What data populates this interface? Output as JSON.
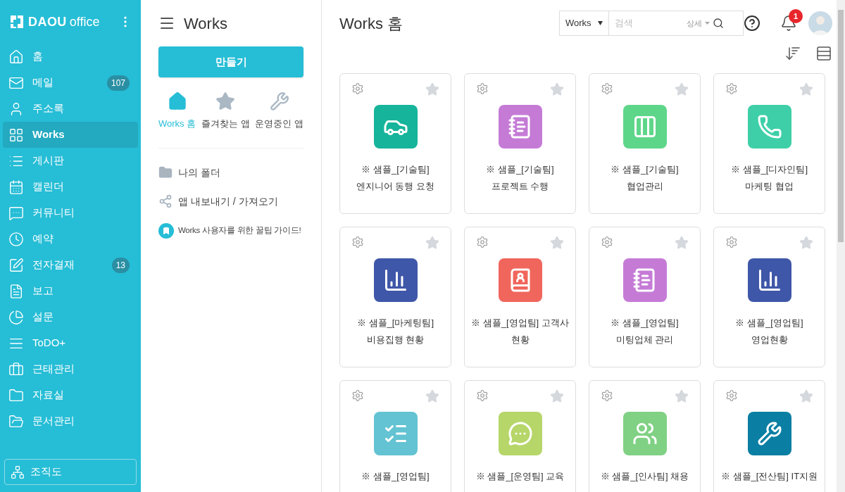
{
  "brand": {
    "logo_bold": "DAOU",
    "logo_light": "office"
  },
  "nav": [
    {
      "label": "홈",
      "selected": false
    },
    {
      "label": "메일",
      "selected": false,
      "badge": "107"
    },
    {
      "label": "주소록",
      "selected": false
    },
    {
      "label": "Works",
      "selected": true
    },
    {
      "label": "게시판",
      "selected": false
    },
    {
      "label": "캘린더",
      "selected": false
    },
    {
      "label": "커뮤니티",
      "selected": false
    },
    {
      "label": "예약",
      "selected": false
    },
    {
      "label": "전자결재",
      "selected": false,
      "badge": "13"
    },
    {
      "label": "보고",
      "selected": false
    },
    {
      "label": "설문",
      "selected": false
    },
    {
      "label": "ToDO+",
      "selected": false
    },
    {
      "label": "근태관리",
      "selected": false
    },
    {
      "label": "자료실",
      "selected": false
    },
    {
      "label": "문서관리",
      "selected": false
    }
  ],
  "org_button": "조직도",
  "panel": {
    "title": "Works",
    "create_button": "만들기",
    "shortcuts": [
      {
        "label": "Works 홈",
        "selected": true
      },
      {
        "label": "즐겨찾는 앱",
        "selected": false
      },
      {
        "label": "운영중인 앱",
        "selected": false
      }
    ],
    "links": [
      "나의 폴더",
      "앱 내보내기 / 가져오기"
    ],
    "guide": "Works 사용자를 위한 꿀팁 가이드!"
  },
  "main": {
    "title": "Works 홈",
    "search": {
      "scope": "Works",
      "placeholder": "검색",
      "detail": "상세"
    },
    "notifications": "1",
    "apps": [
      {
        "title": "※ 샘플_[기술팀]",
        "subtitle": "엔지니어 동행 요청",
        "color": "#16b49a"
      },
      {
        "title": "※ 샘플_[기술팀]",
        "subtitle": "프로젝트 수행",
        "color": "#c57bd6"
      },
      {
        "title": "※ 샘플_[기술팀]",
        "subtitle": "협업관리",
        "color": "#5ed68a"
      },
      {
        "title": "※ 샘플_[디자인팀]",
        "subtitle": "마케팅 협업",
        "color": "#3ecfa8"
      },
      {
        "title": "※ 샘플_[마케팅팀]",
        "subtitle": "비용집행 현황",
        "color": "#3f57a8"
      },
      {
        "title": "※ 샘플_[영업팀] 고객사",
        "subtitle": "현황",
        "color": "#f0665c"
      },
      {
        "title": "※ 샘플_[영업팀]",
        "subtitle": "미팅업체 관리",
        "color": "#c57bd6"
      },
      {
        "title": "※ 샘플_[영업팀]",
        "subtitle": "영업현황",
        "color": "#3f57a8"
      },
      {
        "title": "※ 샘플_[영업팀]",
        "color": "#63c3d2"
      },
      {
        "title": "※ 샘플_[운영팀] 교육",
        "color": "#b6d66a"
      },
      {
        "title": "※ 샘플_[인사팀] 채용",
        "color": "#80d184"
      },
      {
        "title": "※ 샘플_[전산팀] IT지원",
        "color": "#0a7fa3"
      }
    ]
  }
}
